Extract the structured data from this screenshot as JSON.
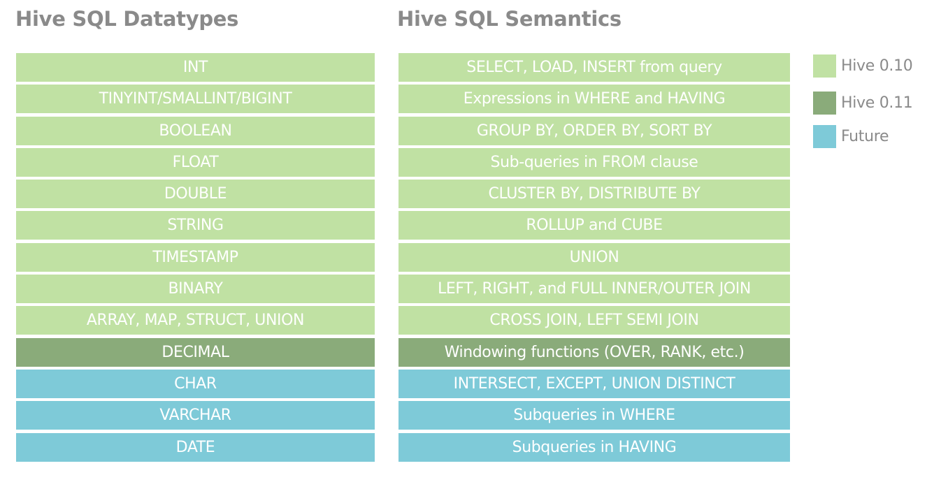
{
  "colors": {
    "hive_0_10": "#c0e1a3",
    "hive_0_11": "#8aab7a",
    "future": "#7ecad8",
    "heading_text": "#8a8a8a"
  },
  "datatypes": {
    "title": "Hive SQL Datatypes",
    "rows": [
      {
        "label": "INT",
        "status": "v010"
      },
      {
        "label": "TINYINT/SMALLINT/BIGINT",
        "status": "v010"
      },
      {
        "label": "BOOLEAN",
        "status": "v010"
      },
      {
        "label": "FLOAT",
        "status": "v010"
      },
      {
        "label": "DOUBLE",
        "status": "v010"
      },
      {
        "label": "STRING",
        "status": "v010"
      },
      {
        "label": "TIMESTAMP",
        "status": "v010"
      },
      {
        "label": "BINARY",
        "status": "v010"
      },
      {
        "label": "ARRAY, MAP, STRUCT, UNION",
        "status": "v010"
      },
      {
        "label": "DECIMAL",
        "status": "v011"
      },
      {
        "label": "CHAR",
        "status": "future"
      },
      {
        "label": "VARCHAR",
        "status": "future"
      },
      {
        "label": "DATE",
        "status": "future"
      }
    ]
  },
  "semantics": {
    "title": "Hive SQL Semantics",
    "rows": [
      {
        "label": "SELECT, LOAD, INSERT from query",
        "status": "v010"
      },
      {
        "label": "Expressions in WHERE and HAVING",
        "status": "v010"
      },
      {
        "label": "GROUP BY, ORDER BY, SORT BY",
        "status": "v010"
      },
      {
        "label": "Sub-queries in FROM clause",
        "status": "v010"
      },
      {
        "label": "CLUSTER BY, DISTRIBUTE BY",
        "status": "v010"
      },
      {
        "label": "ROLLUP and CUBE",
        "status": "v010"
      },
      {
        "label": "UNION",
        "status": "v010"
      },
      {
        "label": "LEFT, RIGHT, and FULL INNER/OUTER JOIN",
        "status": "v010"
      },
      {
        "label": "CROSS JOIN, LEFT SEMI JOIN",
        "status": "v010"
      },
      {
        "label": "Windowing functions (OVER, RANK, etc.)",
        "status": "v011"
      },
      {
        "label": "INTERSECT, EXCEPT, UNION DISTINCT",
        "status": "future"
      },
      {
        "label": "Subqueries in WHERE",
        "status": "future"
      },
      {
        "label": "Subqueries in HAVING",
        "status": "future"
      }
    ]
  },
  "legend": [
    {
      "label": "Hive 0.10",
      "status": "v010"
    },
    {
      "label": "Hive 0.11",
      "status": "v011"
    },
    {
      "label": "Future",
      "status": "future"
    }
  ]
}
